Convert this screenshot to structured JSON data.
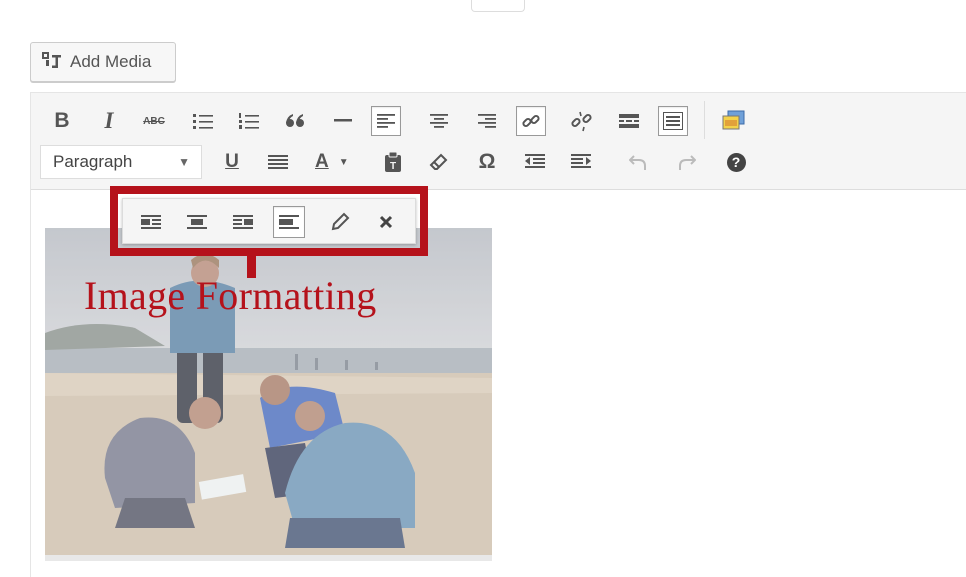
{
  "media": {
    "add_media_label": "Add Media"
  },
  "editor": {
    "format_select": {
      "value": "Paragraph"
    },
    "toolbar_row1": [
      "bold-icon",
      "italic-icon",
      "strikethrough-icon",
      "bulleted-list-icon",
      "numbered-list-icon",
      "blockquote-icon",
      "horizontal-line-icon",
      "align-left-icon",
      "align-center-icon",
      "align-right-icon",
      "insert-link-icon",
      "remove-link-icon",
      "read-more-icon",
      "toolbar-toggle-icon",
      "fullscreen-icon"
    ],
    "toolbar_row2": [
      "underline-icon",
      "justify-icon",
      "text-color-icon",
      "paste-as-text-icon",
      "clear-formatting-icon",
      "special-character-icon",
      "decrease-indent-icon",
      "increase-indent-icon",
      "undo-icon",
      "redo-icon",
      "help-icon"
    ],
    "glyphs": {
      "bold": "B",
      "italic": "I",
      "strike": "ABC",
      "underline": "U",
      "text_color": "A",
      "special_char": "Ω",
      "help": "?"
    }
  },
  "image_toolbar": {
    "buttons": [
      "align-left-icon",
      "align-center-icon",
      "align-right-icon",
      "align-none-icon",
      "edit-icon",
      "remove-icon"
    ],
    "active": "align-none-icon"
  },
  "annotation": {
    "label": "Image Formatting",
    "color": "#b5121b"
  },
  "colors": {
    "toolbar_bg": "#f5f5f5",
    "icon": "#555555",
    "accent": "#b5121b"
  }
}
